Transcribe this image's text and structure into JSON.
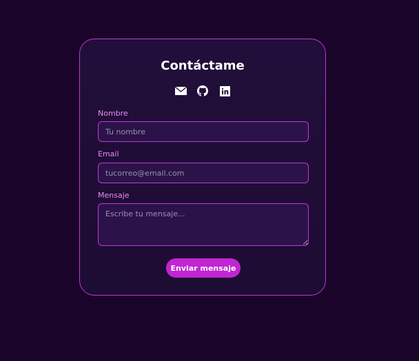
{
  "title": "Contáctame",
  "icons": [
    "email-icon",
    "github-icon",
    "linkedin-icon"
  ],
  "fields": {
    "name": {
      "label": "Nombre",
      "placeholder": "Tu nombre"
    },
    "email": {
      "label": "Email",
      "placeholder": "tucorreo@email.com"
    },
    "message": {
      "label": "Mensaje",
      "placeholder": "Escribe tu mensaje..."
    }
  },
  "submit_label": "Enviar mensaje"
}
